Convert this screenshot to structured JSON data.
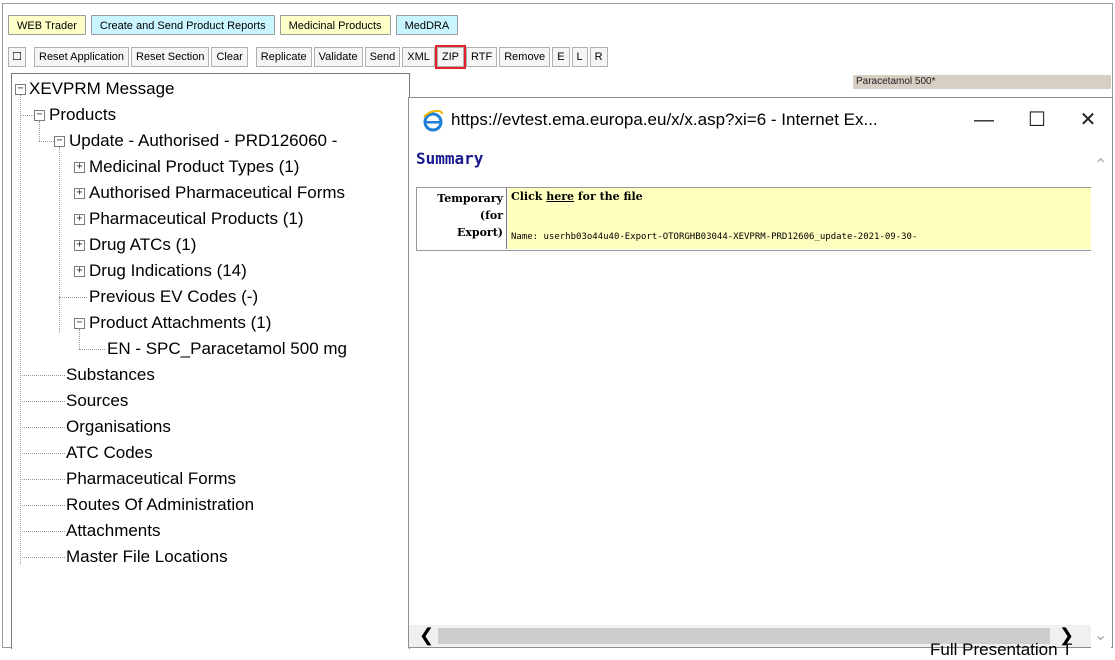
{
  "tabs": {
    "web_trader": "WEB Trader",
    "create_send": "Create and Send Product Reports",
    "medicinal": "Medicinal Products",
    "meddra": "MedDRA"
  },
  "toolbar": {
    "square": "☐",
    "reset_app": "Reset Application",
    "reset_section": "Reset Section",
    "clear": "Clear",
    "replicate": "Replicate",
    "validate": "Validate",
    "send": "Send",
    "xml": "XML",
    "zip": "ZIP",
    "rtf": "RTF",
    "remove": "Remove",
    "e": "E",
    "l": "L",
    "r": "R"
  },
  "tree": {
    "root": "XEVPRM Message",
    "products": "Products",
    "update": "Update - Authorised - PRD126060 -",
    "medicinal_types": "Medicinal Product Types (1)",
    "auth_pharma_forms": "Authorised Pharmaceutical Forms",
    "pharma_products": "Pharmaceutical Products (1)",
    "drug_atcs": "Drug ATCs (1)",
    "drug_indications": "Drug Indications (14)",
    "prev_ev_codes": "Previous EV Codes (-)",
    "product_attachments": "Product Attachments (1)",
    "attachment_en": "EN - SPC_Paracetamol 500 mg",
    "substances": "Substances",
    "sources": "Sources",
    "organisations": "Organisations",
    "atc_codes": "ATC Codes",
    "pharma_forms": "Pharmaceutical Forms",
    "routes": "Routes Of Administration",
    "attachments": "Attachments",
    "master_file": "Master File Locations"
  },
  "caption": "Paracetamol 500*",
  "popup": {
    "title": "https://evtest.ema.europa.eu/x/x.asp?xi=6 - Internet Ex...",
    "minimize": "—",
    "maximize": "☐",
    "close": "✕",
    "summary": "Summary",
    "left_label_1": "Temporary",
    "left_label_2": "(for",
    "left_label_3": "Export)",
    "click_pre": "Click ",
    "click_link": "here",
    "click_post": " for the file",
    "name_line": "Name: userhb03o44u40-Export-OTORGHB03044-XEVPRM-PRD12606_update-2021-09-30-"
  },
  "cutoff_text": "Full Presentation T"
}
